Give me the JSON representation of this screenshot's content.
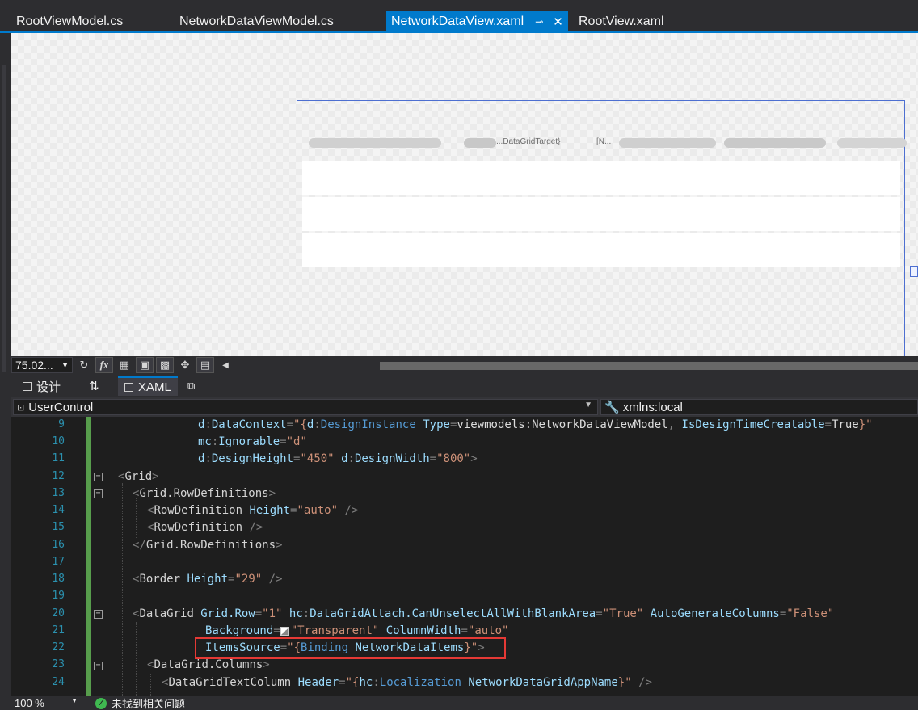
{
  "tabs": [
    {
      "label": "RootViewModel.cs",
      "active": false
    },
    {
      "label": "NetworkDataViewModel.cs",
      "active": false
    },
    {
      "label": "NetworkDataView.xaml",
      "active": true
    },
    {
      "label": "RootView.xaml",
      "active": false
    }
  ],
  "tab_icons": {
    "pin": "pin-icon",
    "close": "close-icon"
  },
  "design_surface": {
    "header_fragments": [
      "...DataGridTarget}",
      "[N..."
    ]
  },
  "design_toolbar": {
    "zoom": "75.02...",
    "buttons": [
      "refresh-icon",
      "fx-icon",
      "grid-icon",
      "snap-grid-icon",
      "checkerboard-icon",
      "snap-lines-icon",
      "device-icon"
    ]
  },
  "split_tabs": {
    "design_label": "设计",
    "swap_label": "⇅",
    "xaml_label": "XAML",
    "popout": "popout-icon"
  },
  "navbar": {
    "left_combo": "UserControl",
    "right_combo": "xmlns:local"
  },
  "editor": {
    "line_numbers": [
      "9",
      "10",
      "11",
      "12",
      "13",
      "14",
      "15",
      "16",
      "17",
      "18",
      "19",
      "20",
      "21",
      "22",
      "23",
      "24"
    ]
  },
  "statusbar": {
    "zoom": "100 %",
    "message": "未找到相关问题"
  },
  "colors": {
    "accent": "#007acc",
    "highlight_box": "#e53935",
    "change_bar": "#579d4c"
  }
}
